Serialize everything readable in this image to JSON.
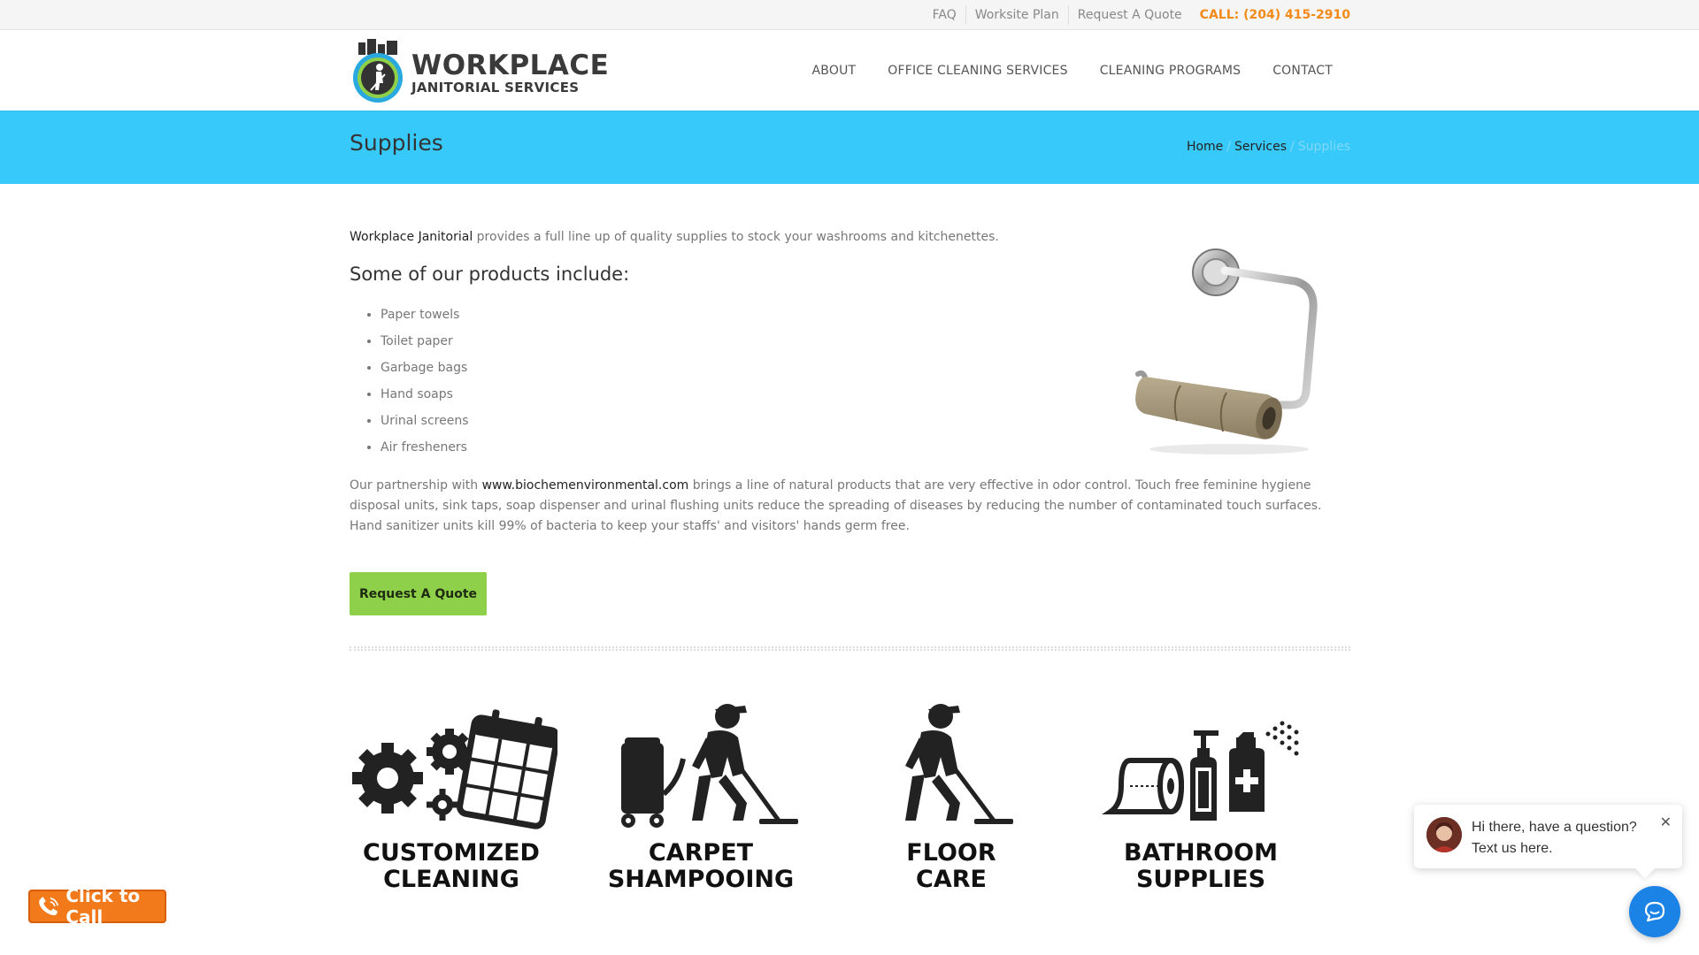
{
  "topbar": {
    "links": [
      "FAQ",
      "Worksite Plan",
      "Request A Quote"
    ],
    "call": "CALL: (204) 415-2910"
  },
  "logo": {
    "line1": "WORKPLACE",
    "line2": "JANITORIAL SERVICES"
  },
  "nav": {
    "items": [
      "ABOUT",
      "OFFICE CLEANING SERVICES",
      "CLEANING PROGRAMS",
      "CONTACT"
    ]
  },
  "pagebar": {
    "title": "Supplies",
    "breadcrumb": [
      "Home",
      "Services",
      "Supplies"
    ],
    "separator": "/"
  },
  "content": {
    "intro_link": "Workplace Janitorial",
    "intro_text": " provides a full line up of quality supplies to stock your washrooms and kitchenettes.",
    "heading": "Some of our products include:",
    "products": [
      "Paper towels",
      "Toilet paper",
      "Garbage bags",
      "Hand soaps",
      "Urinal screens",
      "Air fresheners"
    ],
    "partner_before": "Our partnership with ",
    "partner_link": "www.biochemenvironmental.com",
    "partner_after": " brings a line of natural products that are very effective in odor control. Touch free feminine hygiene disposal units, sink taps, soap dispenser and urinal flushing units reduce the spreading of diseases by reducing the number of contaminated touch surfaces. Hand sanitizer units kill 99% of bacteria to keep your staffs' and visitors' hands germ free.",
    "quote_button": "Request A Quote"
  },
  "services": [
    {
      "title": "CUSTOMIZED\nCLEANING",
      "icon": "gears-calendar-icon"
    },
    {
      "title": "CARPET\nSHAMPOOING",
      "icon": "carpet-cleaner-icon"
    },
    {
      "title": "FLOOR\nCARE",
      "icon": "floor-mop-icon"
    },
    {
      "title": "BATHROOM\nSUPPLIES",
      "icon": "bathroom-supplies-icon"
    }
  ],
  "click_to_call": "Click to Call",
  "chat": {
    "message": "Hi there, have a question? Text us here.",
    "close": "✕"
  },
  "colors": {
    "accent_blue": "#38c9fb",
    "call_orange": "#f28a1a",
    "button_green": "#8fd04b",
    "chat_blue": "#1b83e6"
  }
}
